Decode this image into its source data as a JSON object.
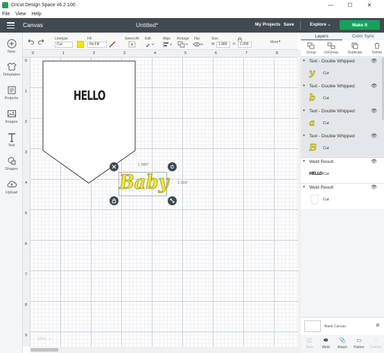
{
  "window": {
    "title": "Cricut Design Space  v6.2.100",
    "minimize": "—",
    "maximize": "☐",
    "close": "✕"
  },
  "menu": [
    "File",
    "View",
    "Help"
  ],
  "header": {
    "section": "Canvas",
    "doc_title": "Untitled*",
    "my_projects": "My Projects",
    "save": "Save",
    "explore": "Explore",
    "make_it": "Make It"
  },
  "left_tools": [
    {
      "label": "New",
      "icon": "plus-circle-icon"
    },
    {
      "label": "Templates",
      "icon": "shirt-icon"
    },
    {
      "label": "Projects",
      "icon": "projects-icon"
    },
    {
      "label": "Images",
      "icon": "image-icon"
    },
    {
      "label": "Text",
      "icon": "text-icon"
    },
    {
      "label": "Shapes",
      "icon": "shapes-icon"
    },
    {
      "label": "Upload",
      "icon": "cloud-upload-icon"
    }
  ],
  "edit_toolbar": {
    "linetype_label": "Linetype",
    "linetype_value": "Cut",
    "fill_label": "Fill",
    "fill_value": "No Fill",
    "select_all": "Select All",
    "edit": "Edit",
    "align": "Align",
    "arrange": "Arrange",
    "flip": "Flip",
    "size": "Size",
    "w_label": "W",
    "w_value": "1.989",
    "h_label": "H",
    "h_value": "1.009",
    "more": "More",
    "linetype_color": "#f5e600"
  },
  "ruler": {
    "top": [
      "0",
      "1",
      "2",
      "3",
      "4",
      "5",
      "6",
      "7",
      "8"
    ],
    "left": [
      "0",
      "1",
      "2",
      "3",
      "4",
      "5",
      "6",
      "7",
      "8",
      "9"
    ]
  },
  "canvas": {
    "banner_text": "HELLO",
    "baby_text": "Baby",
    "width_dim": "1.989\"",
    "height_dim": "1.009\"",
    "zoom": "100%"
  },
  "right_panel": {
    "tabs": [
      "Layers",
      "Color Sync"
    ],
    "actions": [
      "Group",
      "UnGroup",
      "Duplicate",
      "Delete"
    ],
    "groups": [
      {
        "name": "Text - Double Whipped",
        "op": "Cut",
        "glyph": "y"
      },
      {
        "name": "Text - Double Whipped",
        "op": "Cut",
        "glyph": "b"
      },
      {
        "name": "Text - Double Whipped",
        "op": "Cut",
        "glyph": "a"
      },
      {
        "name": "Text - Double Whipped",
        "op": "Cut",
        "glyph": "B"
      },
      {
        "name": "Weld Result",
        "op": "Cut",
        "glyph": "HELLO"
      },
      {
        "name": "Weld Result",
        "op": "Cut",
        "glyph": ""
      }
    ],
    "blank_canvas": "Blank Canvas",
    "bottom_actions": [
      "Slice",
      "Weld",
      "Attach",
      "Flatten",
      "Contour"
    ]
  }
}
